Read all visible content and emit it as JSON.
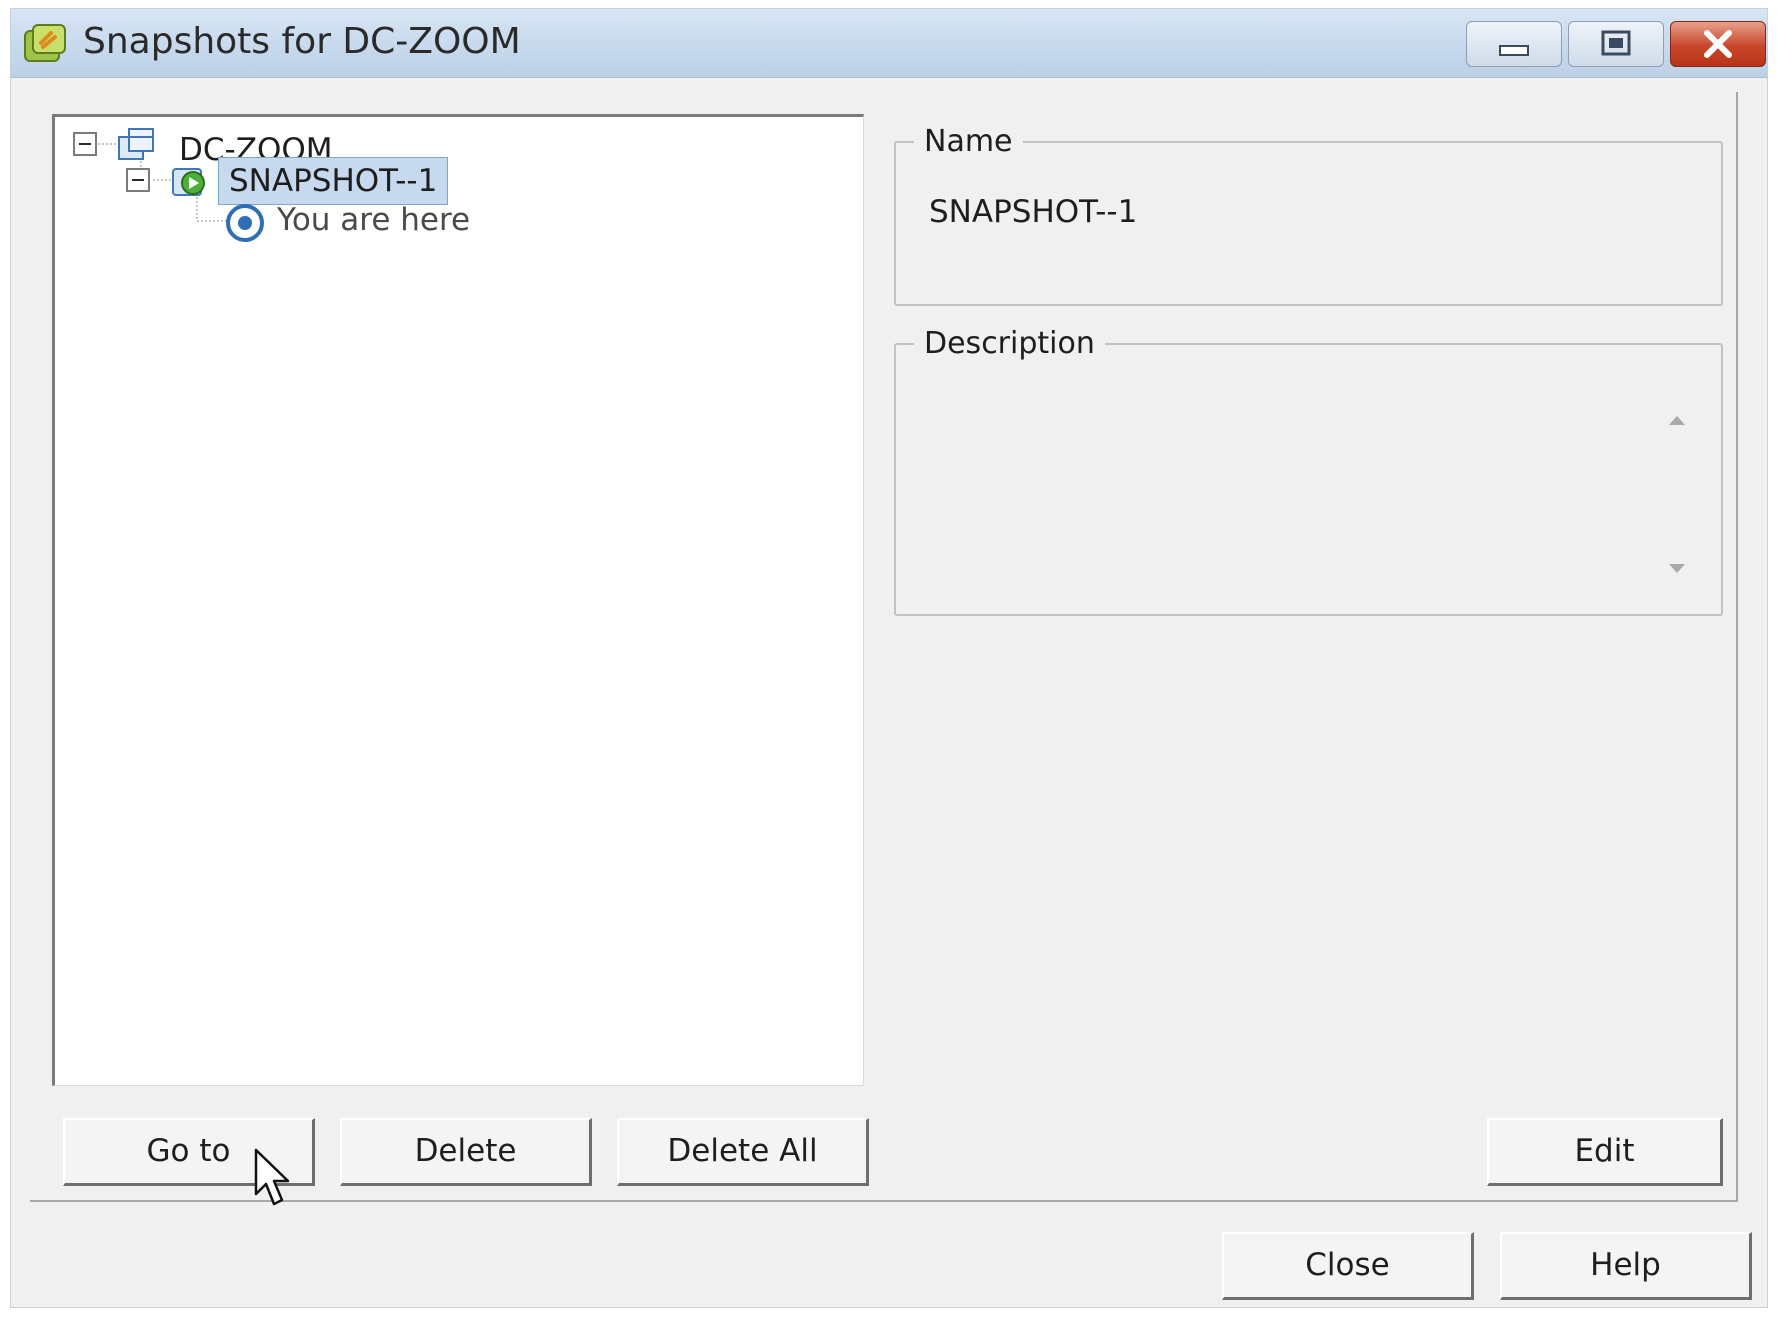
{
  "window": {
    "title": "Snapshots for DC-ZOOM",
    "controls": {
      "minimize_icon": "minimize-icon",
      "maximize_icon": "maximize-icon",
      "close_icon": "close-icon"
    }
  },
  "tree": {
    "root": {
      "label": "DC-ZOOM",
      "icon": "vm-icon",
      "expanded": true
    },
    "snapshot": {
      "label": "SNAPSHOT--1",
      "icon": "snapshot-icon",
      "expanded": true,
      "selected": true
    },
    "current": {
      "label": "You are here",
      "icon": "you-are-here-icon"
    }
  },
  "details": {
    "name_legend": "Name",
    "name_value": "SNAPSHOT--1",
    "description_legend": "Description",
    "description_value": ""
  },
  "actions": {
    "goto_label": "Go to",
    "delete_label": "Delete",
    "delete_all_label": "Delete All",
    "edit_label": "Edit",
    "close_label": "Close",
    "help_label": "Help"
  },
  "colors": {
    "selection_bg": "#c6d9ef",
    "close_button": "#c8462c",
    "titlebar": "#c6d8ec"
  }
}
